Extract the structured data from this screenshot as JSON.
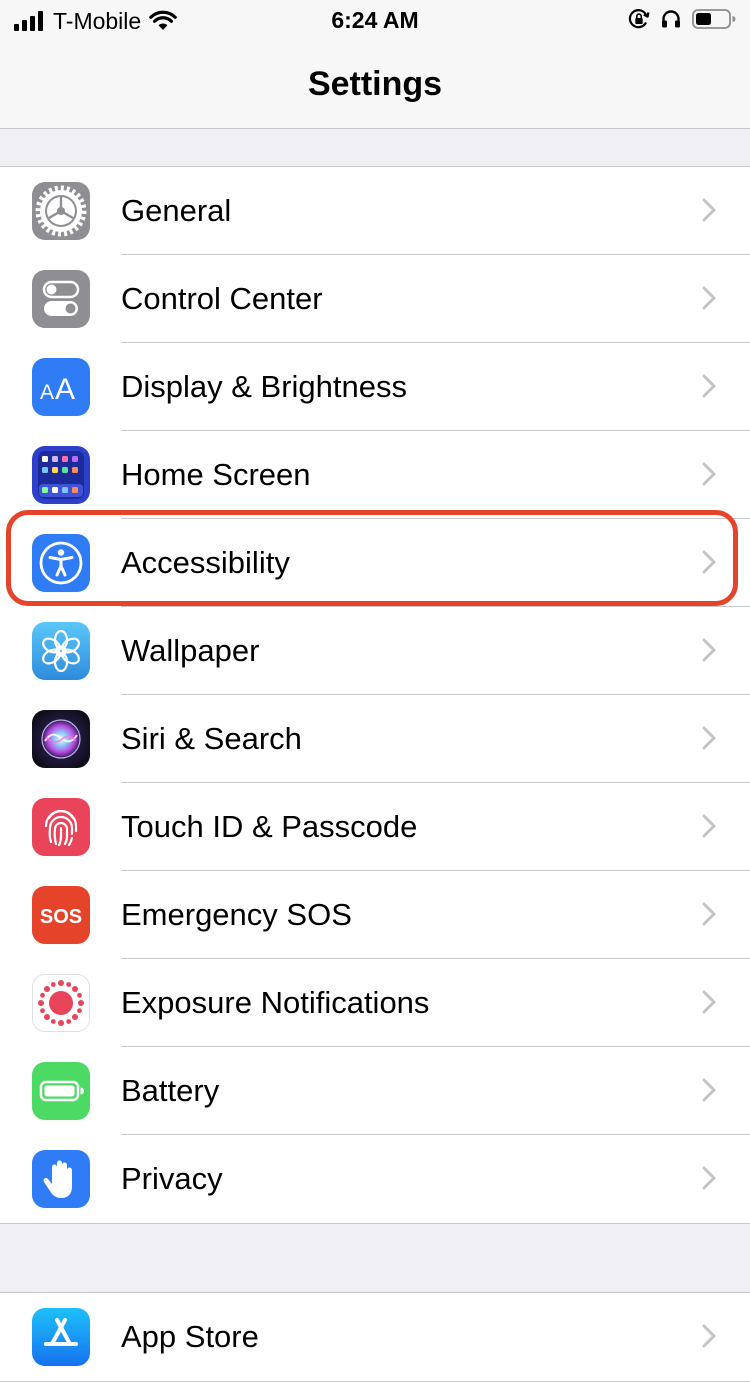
{
  "status_bar": {
    "carrier": "T-Mobile",
    "time": "6:24 AM",
    "icons": [
      "signal-icon",
      "wifi-icon",
      "orientation-lock-icon",
      "headphones-icon",
      "battery-icon"
    ]
  },
  "nav": {
    "title": "Settings"
  },
  "groups": [
    {
      "items": [
        {
          "label": "General",
          "icon": "gear-icon",
          "color": "#8e8e93"
        },
        {
          "label": "Control Center",
          "icon": "toggles-icon",
          "color": "#8e8e93"
        },
        {
          "label": "Display & Brightness",
          "icon": "text-size-icon",
          "color": "#2f7cf6"
        },
        {
          "label": "Home Screen",
          "icon": "app-grid-icon",
          "color": "#2c40c9"
        },
        {
          "label": "Accessibility",
          "icon": "accessibility-person-icon",
          "color": "#2f7cf6",
          "highlighted": true
        },
        {
          "label": "Wallpaper",
          "icon": "flower-icon",
          "color": "#36a6de"
        },
        {
          "label": "Siri & Search",
          "icon": "siri-icon",
          "color": "#1c1c2e"
        },
        {
          "label": "Touch ID & Passcode",
          "icon": "fingerprint-icon",
          "color": "#e9445a"
        },
        {
          "label": "Emergency SOS",
          "icon": "sos-icon",
          "color": "#e5432a",
          "icon_text": "SOS"
        },
        {
          "label": "Exposure Notifications",
          "icon": "exposure-icon",
          "color": "#e9445a"
        },
        {
          "label": "Battery",
          "icon": "battery-app-icon",
          "color": "#4cd964"
        },
        {
          "label": "Privacy",
          "icon": "hand-icon",
          "color": "#2f7cf6"
        }
      ]
    },
    {
      "items": [
        {
          "label": "App Store",
          "icon": "app-store-icon",
          "color": "#1e9bf0"
        }
      ]
    }
  ],
  "colors": {
    "highlight": "#e5432a",
    "separator": "#c8c7cc",
    "chevron": "#c4c4c7"
  }
}
